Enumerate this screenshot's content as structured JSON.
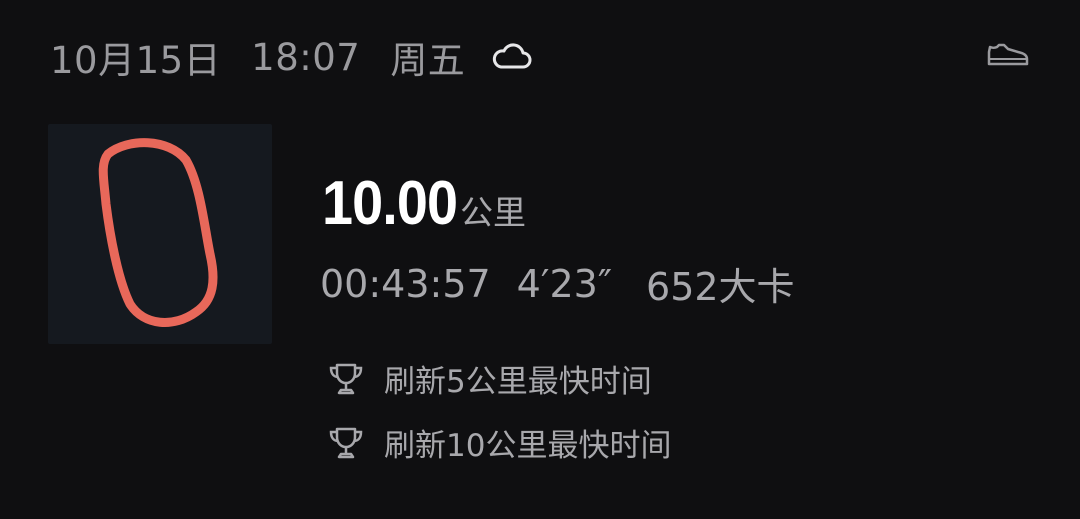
{
  "header": {
    "date": "10月15日",
    "time": "18:07",
    "weekday": "周五",
    "weather_icon": "cloud-icon",
    "shoe_icon": "shoe-icon"
  },
  "run": {
    "distance": "10.00",
    "distance_unit": "公里",
    "duration": "00:43:57",
    "pace": "4′23″",
    "calories": "652大卡",
    "route_color": "#e8685a"
  },
  "records": [
    {
      "label": "刷新5公里最快时间",
      "icon": "trophy-icon"
    },
    {
      "label": "刷新10公里最快时间",
      "icon": "trophy-icon"
    }
  ]
}
